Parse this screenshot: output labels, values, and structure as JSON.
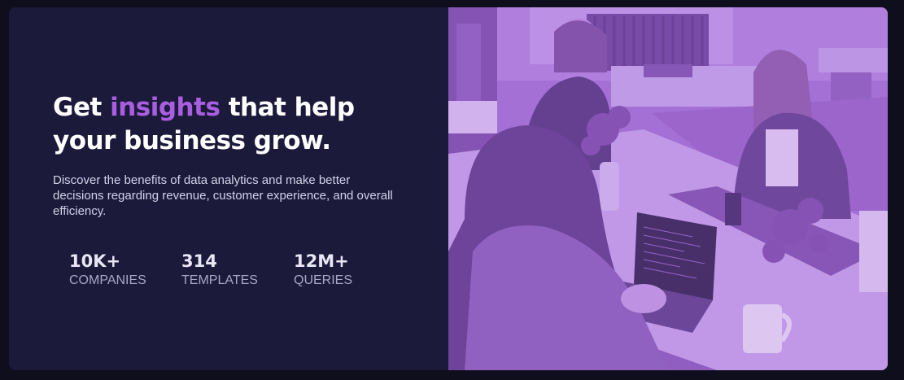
{
  "hero": {
    "title_before": "Get ",
    "title_accent": "insights",
    "title_after": " that help your business grow.",
    "description": "Discover the benefits of data analytics and make better decisions regarding revenue, customer experience, and overall efficiency.",
    "stats": [
      {
        "value": "10K+",
        "label": "Companies"
      },
      {
        "value": "314",
        "label": "Templates"
      },
      {
        "value": "12M+",
        "label": "Queries"
      }
    ]
  },
  "colors": {
    "background": "#1b1a3b",
    "accent": "#a95ee0",
    "photo_tint": "#a56ed6"
  },
  "image": {
    "icon": "office-team-photo"
  }
}
